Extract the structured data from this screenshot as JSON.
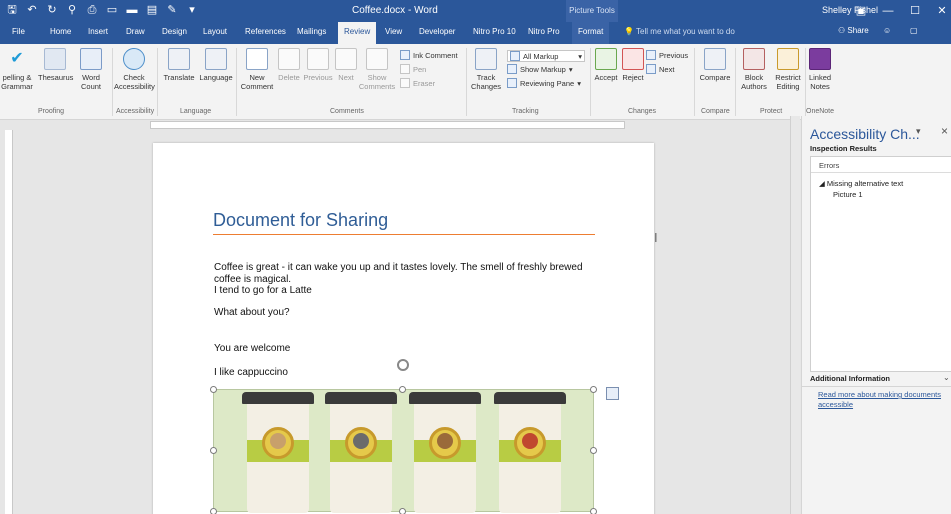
{
  "window": {
    "title": "Coffee.docx - Word",
    "picture_tools": "Picture Tools",
    "user": "Shelley Fishel",
    "minimize": "—",
    "restore": "☐",
    "close": "✕"
  },
  "tabs": [
    "File",
    "Home",
    "Insert",
    "Draw",
    "Design",
    "Layout",
    "References",
    "Mailings",
    "Review",
    "View",
    "Developer",
    "Nitro Pro 10",
    "Nitro Pro",
    "Format"
  ],
  "active_tab": "Review",
  "tell_me": "Tell me what you want to do",
  "share": "Share",
  "ribbon": {
    "spelling": "pelling &\nGrammar",
    "thesaurus": "Thesaurus",
    "word_count": "Word\nCount",
    "proofing": "Proofing",
    "check_accessibility": "Check\nAccessibility",
    "accessibility": "Accessibility",
    "translate": "Translate",
    "language": "Language",
    "language_grp": "Language",
    "new_comment": "New\nComment",
    "delete": "Delete",
    "previous": "Previous",
    "next": "Next",
    "show_comments": "Show\nComments",
    "ink_comment": "Ink Comment",
    "pen": "Pen",
    "eraser": "Eraser",
    "comments_grp": "Comments",
    "track_changes": "Track\nChanges",
    "all_markup": "All Markup",
    "show_markup": "Show Markup",
    "reviewing_pane": "Reviewing Pane",
    "tracking_grp": "Tracking",
    "accept": "Accept",
    "reject": "Reject",
    "prev_change": "Previous",
    "next_change": "Next",
    "changes_grp": "Changes",
    "compare": "Compare",
    "compare_grp": "Compare",
    "block_authors": "Block\nAuthors",
    "restrict_editing": "Restrict\nEditing",
    "protect_grp": "Protect",
    "linked_notes": "Linked\nNotes",
    "onenote_grp": "OneNote"
  },
  "document": {
    "heading": "Document for Sharing",
    "para1_line1": "Coffee is great - it can wake you up and it tastes lovely. The smell of freshly brewed",
    "para1_line2": "coffee is magical.",
    "para2": "I tend to go for a Latte",
    "para3": "What about you?",
    "para4": "You are welcome",
    "para5": "I like cappuccino"
  },
  "picture": {
    "cups": [
      {
        "face_color": "#c8a06b"
      },
      {
        "face_color": "#6b6b6b"
      },
      {
        "face_color": "#9a6a3a"
      },
      {
        "face_color": "#c0482f"
      }
    ]
  },
  "accessibility_pane": {
    "title": "Accessibility Ch...",
    "inspection_results": "Inspection Results",
    "errors": "Errors",
    "issue_category": "Missing alternative text",
    "issue_item": "Picture 1",
    "additional_info": "Additional Information",
    "read_more": "Read more about making documents accessible"
  },
  "colors": {
    "accent": "#2b579a",
    "heading": "#2f5d96",
    "heading_rule": "#ed7d31",
    "picture_bg": "#dde9c7"
  }
}
